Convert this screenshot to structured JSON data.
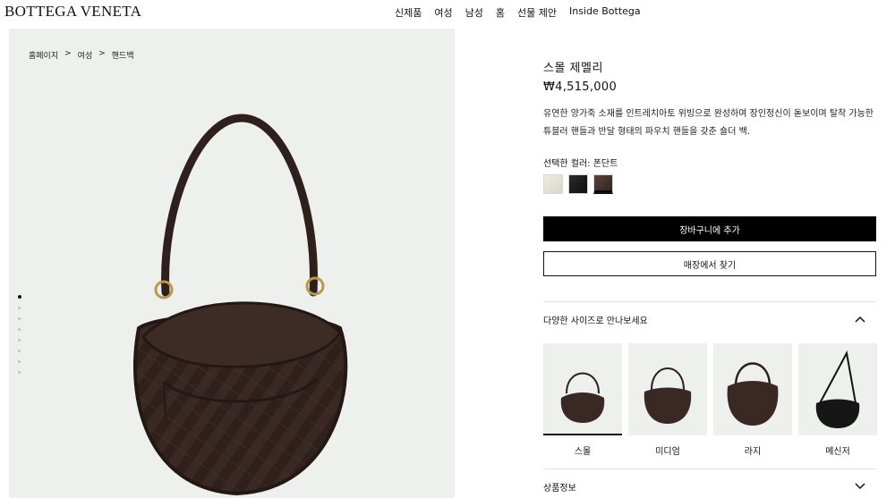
{
  "brand": {
    "logo": "BOTTEGA VENETA"
  },
  "nav": {
    "items": [
      "신제품",
      "여성",
      "남성",
      "홈",
      "선물 제안",
      "Inside Bottega"
    ]
  },
  "breadcrumb": [
    "홈페이지",
    ">",
    "여성",
    ">",
    "핸드백"
  ],
  "gallery": {
    "image_count": 8,
    "active_index": 0
  },
  "product": {
    "title": "스몰 제멜리",
    "price": "₩4,515,000",
    "description": "유연한 양가죽 소재를 인트레치아토 위빙으로 완성하여 장인정신이 돋보이며 탈착 가능한 튜블러 핸들과 반달 형태의 파우치 핸들을 갖춘 숄더 백.",
    "color_label": "선택한 컬러: 폰단트",
    "swatches": [
      {
        "name": "ivory",
        "color": "#e6e2d6"
      },
      {
        "name": "black",
        "color": "#161616"
      },
      {
        "name": "fondant",
        "color": "#3d2c28",
        "selected": true
      }
    ]
  },
  "actions": {
    "add_to_cart": "장바구니에 추가",
    "find_store": "매장에서 찾기"
  },
  "sizes": {
    "heading": "다양한 사이즈로 만나보세요",
    "items": [
      {
        "label": "스몰",
        "active": true
      },
      {
        "label": "미디엄"
      },
      {
        "label": "라지"
      },
      {
        "label": "메신저"
      }
    ]
  },
  "product_info": {
    "heading": "상품정보"
  },
  "colors": {
    "bag": "#3a2824",
    "gallery_bg": "#eef0ee",
    "gold": "#b89a4a"
  },
  "icons": {
    "sizes_toggle": "chevron-up-icon",
    "info_toggle": "chevron-down-icon"
  }
}
